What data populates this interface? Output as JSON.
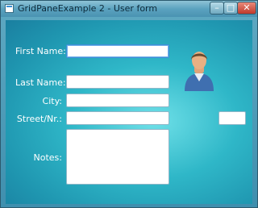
{
  "window": {
    "title": "GridPaneExample 2 - User form",
    "controls": {
      "minimize": "–",
      "maximize": "□",
      "close": "✕"
    }
  },
  "form": {
    "first_name_label": "First Name:",
    "first_name_value": "",
    "last_name_label": "Last Name:",
    "last_name_value": "",
    "city_label": "City:",
    "city_value": "",
    "street_label": "Street/Nr.:",
    "street_value": "",
    "street_number_value": "",
    "notes_label": "Notes:",
    "notes_value": ""
  },
  "icons": {
    "app": "window-app-icon",
    "user": "user-avatar-icon"
  },
  "colors": {
    "background_center": "#6fe0e8",
    "background_edge": "#1a7fa0",
    "focus": "#3f8fd8"
  }
}
